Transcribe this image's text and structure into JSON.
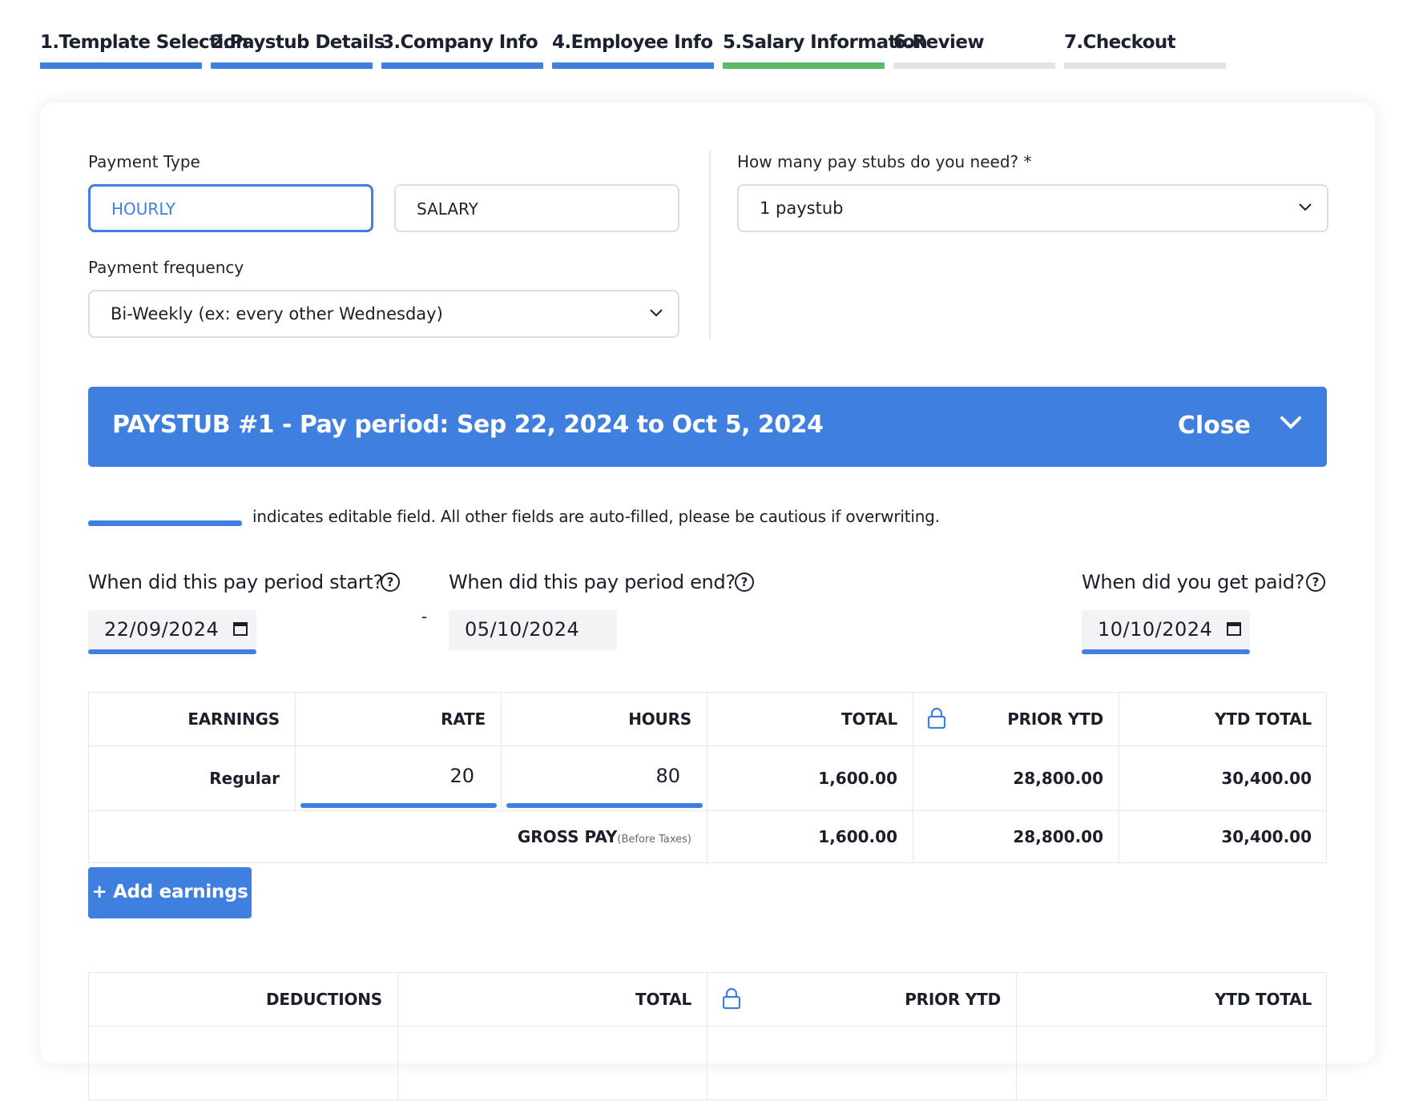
{
  "stepper": {
    "steps": [
      {
        "label": "1.Template Selection",
        "state": "complete"
      },
      {
        "label": "2.Paystub Details",
        "state": "complete"
      },
      {
        "label": "3.Company Info",
        "state": "complete"
      },
      {
        "label": "4.Employee Info",
        "state": "complete"
      },
      {
        "label": "5.Salary Information",
        "state": "current"
      },
      {
        "label": "6.Review",
        "state": "pending"
      },
      {
        "label": "7.Checkout",
        "state": "pending"
      }
    ]
  },
  "payment_type": {
    "label": "Payment Type",
    "options": [
      "HOURLY",
      "SALARY"
    ],
    "selected": "HOURLY"
  },
  "payment_frequency": {
    "label": "Payment frequency",
    "value": "Bi-Weekly (ex: every other Wednesday)"
  },
  "stubs_count": {
    "label": "How many pay stubs do you need? *",
    "value": "1 paystub"
  },
  "paystub": {
    "title": "PAYSTUB #1 -  Pay period: Sep 22, 2024 to Oct 5, 2024",
    "close_label": "Close"
  },
  "legend_text": "indicates editable field. All other fields are auto-filled, please be cautious if overwriting.",
  "dates": {
    "start_label": "When did this pay period start?",
    "start_value": "22/09/2024",
    "separator": "-",
    "end_label": "When did this pay period end?",
    "end_value": "05/10/2024",
    "paid_label": "When did you get paid?",
    "paid_value": "10/10/2024",
    "help_glyph": "?"
  },
  "earnings": {
    "headers": [
      "EARNINGS",
      "RATE",
      "HOURS",
      "TOTAL",
      "PRIOR YTD",
      "YTD TOTAL"
    ],
    "rows": [
      {
        "name": "Regular",
        "rate": "20",
        "hours": "80",
        "total": "1,600.00",
        "prior_ytd": "28,800.00",
        "ytd_total": "30,400.00"
      }
    ],
    "gross": {
      "label": "GROSS PAY",
      "note": "(Before Taxes)",
      "total": "1,600.00",
      "prior_ytd": "28,800.00",
      "ytd_total": "30,400.00"
    }
  },
  "add_earnings_label": "+ Add earnings",
  "deductions": {
    "headers": [
      "DEDUCTIONS",
      "TOTAL",
      "PRIOR YTD",
      "YTD TOTAL"
    ]
  },
  "colors": {
    "accent": "#3f7fe0",
    "current_step": "#5bb968",
    "pending_step": "#e3e4e7"
  },
  "icons": [
    "chevron-down-icon",
    "help-icon",
    "calendar-icon",
    "lock-icon"
  ]
}
